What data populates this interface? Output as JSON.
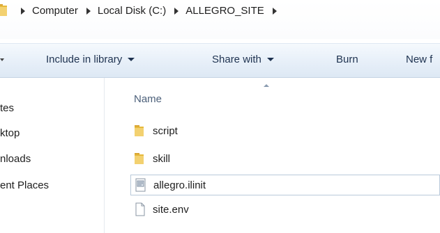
{
  "breadcrumb": {
    "items": [
      "Computer",
      "Local Disk (C:)",
      "ALLEGRO_SITE"
    ]
  },
  "toolbar": {
    "include_label": "Include in library",
    "share_label": "Share with",
    "burn_label": "Burn",
    "new_label": "New f"
  },
  "nav": {
    "items": [
      "tes",
      "ktop",
      "nloads",
      "ent Places"
    ]
  },
  "list": {
    "column_name": "Name",
    "files": [
      {
        "name": "script",
        "icon": "folder-icon"
      },
      {
        "name": "skill",
        "icon": "folder-icon"
      },
      {
        "name": "allegro.ilinit",
        "icon": "config-file-icon"
      },
      {
        "name": "site.env",
        "icon": "file-icon"
      }
    ]
  },
  "colors": {
    "folder": "#e6b93c",
    "selection_border": "#b9c9da",
    "command_bar_text": "#1e3250",
    "header_text": "#4c607a"
  }
}
